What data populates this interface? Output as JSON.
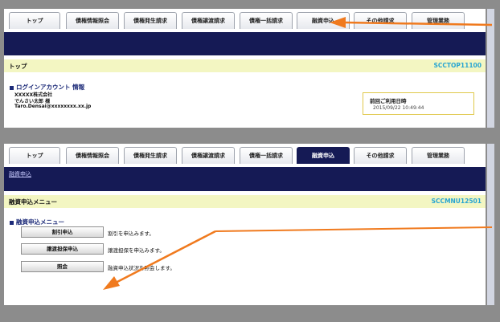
{
  "tabs": [
    {
      "label": "トップ"
    },
    {
      "label": "債権情報照会"
    },
    {
      "label": "債権発生請求"
    },
    {
      "label": "債権譲渡請求"
    },
    {
      "label": "債権一括請求"
    },
    {
      "label": "融資申込"
    },
    {
      "label": "その他請求"
    },
    {
      "label": "管理業務"
    }
  ],
  "screen1": {
    "title": "トップ",
    "code": "SCCTOP11100",
    "login": {
      "heading": "ログインアカウント 情報",
      "company": "XXXXX株式会社",
      "user": "でんさい太郎 様",
      "email": "Taro.Densai@xxxxxxxx.xx.jp"
    },
    "last_login": {
      "label": "前回ご利用日時",
      "value": "2015/09/22 10:49:44"
    }
  },
  "screen2": {
    "breadcrumb": "融資申込",
    "title": "融資申込メニュー",
    "code": "SCCMNU12501",
    "menu_heading": "融資申込メニュー",
    "items": [
      {
        "button": "割引申込",
        "desc": "割引を申込みます。"
      },
      {
        "button": "譲渡担保申込",
        "desc": "譲渡担保を申込みます。"
      },
      {
        "button": "照会",
        "desc": "融資申込状況を照会します。"
      }
    ]
  },
  "colors": {
    "navy": "#151a55",
    "title_bar": "#f3f6c2",
    "code_text": "#27a5d2",
    "arrow": "#f07a1e",
    "outer_bg": "#8c8c8c"
  }
}
